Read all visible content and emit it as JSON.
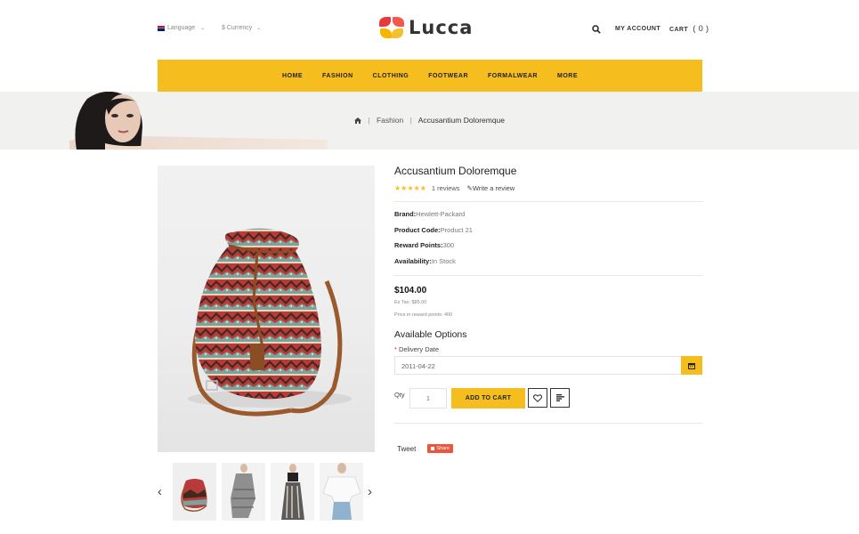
{
  "header": {
    "language_label": "Language",
    "currency_label": "$ Currency",
    "logo_text": "Lucca",
    "my_account": "MY ACCOUNT",
    "cart_label": "CART",
    "cart_count": "( 0 )"
  },
  "nav": {
    "items": [
      "HOME",
      "FASHION",
      "CLOTHING",
      "FOOTWEAR",
      "FORMALWEAR",
      "MORE"
    ]
  },
  "breadcrumb": {
    "home_icon": "home-icon",
    "category": "Fashion",
    "current": "Accusantium Doloremque"
  },
  "product": {
    "title": "Accusantium Doloremque",
    "rating": 5,
    "reviews": "1 reviews",
    "write_review": "Write a review",
    "brand_label": "Brand:",
    "brand": "Hewlett-Packard",
    "code_label": "Product Code:",
    "code": "Product 21",
    "reward_label": "Reward Points:",
    "reward": "300",
    "availability_label": "Availability:",
    "availability": "In Stock",
    "price": "$104.00",
    "ex_tax": "Ex Tax: $85.00",
    "reward_price": "Price in reward points: 400"
  },
  "options": {
    "title": "Available Options",
    "delivery_label": "Delivery Date",
    "delivery_value": "2011-04-22"
  },
  "cart_form": {
    "qty_label": "Qty",
    "qty_value": "1",
    "add_to_cart": "ADD TO CART"
  },
  "social": {
    "tweet": "Tweet",
    "share": "Share"
  },
  "colors": {
    "accent": "#f6bd1f",
    "share": "#e9573f"
  }
}
